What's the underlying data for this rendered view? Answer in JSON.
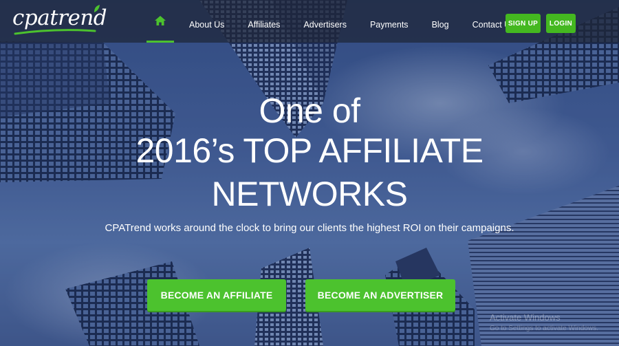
{
  "brand": {
    "logo_cpa": "cpa",
    "logo_trend": "trend",
    "accent_color": "#4cc22e"
  },
  "nav": {
    "home_icon": "home-icon",
    "items": [
      {
        "label": "About Us"
      },
      {
        "label": "Affiliates"
      },
      {
        "label": "Advertisers"
      },
      {
        "label": "Payments"
      },
      {
        "label": "Blog"
      },
      {
        "label": "Contact Us"
      }
    ],
    "signup_label": "SIGN UP",
    "login_label": "LOGIN"
  },
  "hero": {
    "line1": "One of",
    "line2": "2016’s TOP AFFILIATE",
    "line3": "NETWORKS",
    "subtitle": "CPATrend works around the clock to bring our clients the highest ROI on their campaigns.",
    "cta_affiliate": "BECOME AN AFFILIATE",
    "cta_advertiser": "BECOME AN ADVERTISER"
  },
  "os_watermark": {
    "line1": "Activate Windows",
    "line2": "Go to Settings to activate Windows."
  }
}
